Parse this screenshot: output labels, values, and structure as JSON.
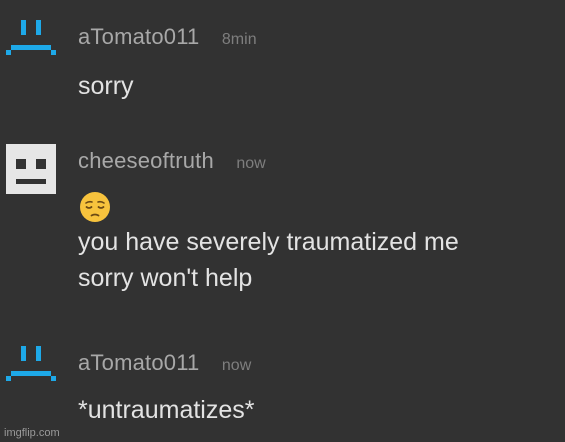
{
  "messages": [
    {
      "username": "aTomato011",
      "time": "8min",
      "avatar_icon": "sad-face-pixel-icon",
      "avatar_color": "#1ea9e8",
      "lines": [
        "sorry"
      ]
    },
    {
      "username": "cheeseoftruth",
      "time": "now",
      "avatar_icon": "neutral-face-pixel-icon",
      "avatar_color": "#e6e6e6",
      "emoji": "pensive-face-emoji",
      "lines": [
        "you have severely traumatized me",
        "sorry won't help"
      ]
    },
    {
      "username": "aTomato011",
      "time": "now",
      "avatar_icon": "sad-face-pixel-icon",
      "avatar_color": "#1ea9e8",
      "lines": [
        "*untraumatizes*"
      ]
    }
  ],
  "watermark": "imgflip.com",
  "colors": {
    "background": "#323232",
    "username": "#a8a8a8",
    "timestamp": "#7e7e7e",
    "message_text": "#e3e3e3",
    "emoji_yellow": "#f7c33d"
  }
}
